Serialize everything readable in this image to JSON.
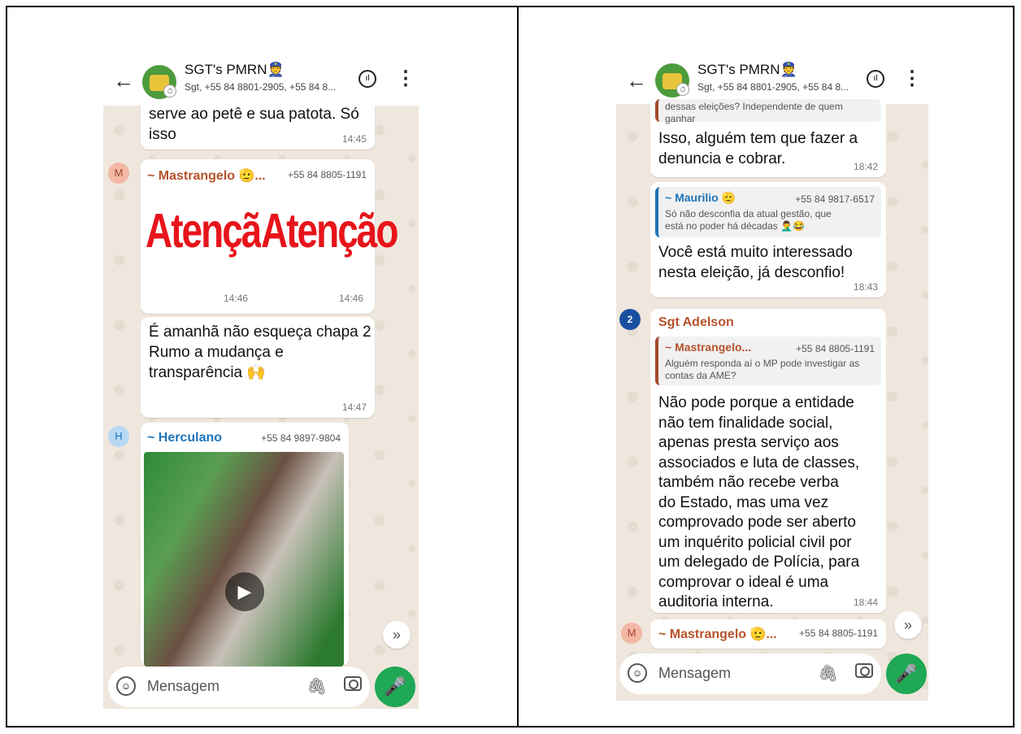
{
  "left": {
    "header": {
      "title": "SGT's PMRN👮",
      "subtitle": "Sgt, +55 84 8801-2905, +55 84 8..."
    },
    "messages": {
      "m1": {
        "text": "serve ao petê e sua patota. Só isso",
        "time": "14:45"
      },
      "m2": {
        "sender": "~ Mastrangelo 🫡...",
        "phone": "+55 84 8805-1191",
        "avatar": "M",
        "img1_text": "Atenção",
        "img1_time": "14:46",
        "img2_text": "Atenção",
        "img2_time": "14:46"
      },
      "m3": {
        "text": "É amanhã não esqueça chapa 2\nRumo a mudança e transparência 🙌",
        "time": "14:47"
      },
      "m4": {
        "sender": "~ Herculano",
        "phone": "+55 84 9897-9804",
        "avatar": "H"
      }
    },
    "input": {
      "placeholder": "Mensagem"
    }
  },
  "right": {
    "header": {
      "title": "SGT's PMRN👮",
      "subtitle": "Sgt, +55 84 8801-2905, +55 84 8..."
    },
    "messages": {
      "m1": {
        "quote_text": "dessas eleições? Independente de quem ganhar",
        "text": "Isso, alguém tem que fazer a denuncia e cobrar.",
        "time": "18:42"
      },
      "m2": {
        "quote_sender": "~ Maurilio 🫡",
        "quote_phone": "+55 84 9817-6517",
        "quote_text": "Só não desconfia da atual gestão, que está no poder há décadas 🤦‍♂️😂",
        "text": "Você está muito interessado nesta eleição, já desconfio!",
        "time": "18:43"
      },
      "m3": {
        "sender": "Sgt Adelson",
        "quote_sender": "~ Mastrangelo...",
        "quote_phone": "+55 84 8805-1191",
        "quote_text": "Alguém responda aí o MP pode investigar as contas da AME?",
        "text": "Não pode porque a entidade não tem finalidade social, apenas presta serviço aos associados e luta de classes, também não recebe verba do Estado, mas uma vez comprovado pode ser aberto um inquérito policial civil por um delegado de Polícia, para comprovar  o ideal é uma auditoria interna.",
        "time": "18:44"
      },
      "m4": {
        "sender": "~ Mastrangelo 🫡...",
        "phone": "+55 84 8805-1191",
        "avatar": "M"
      }
    },
    "input": {
      "placeholder": "Mensagem"
    }
  },
  "colors": {
    "accent": "#1fa855",
    "sender_orange": "#b5532c",
    "sender_blue": "#1d74b9"
  }
}
